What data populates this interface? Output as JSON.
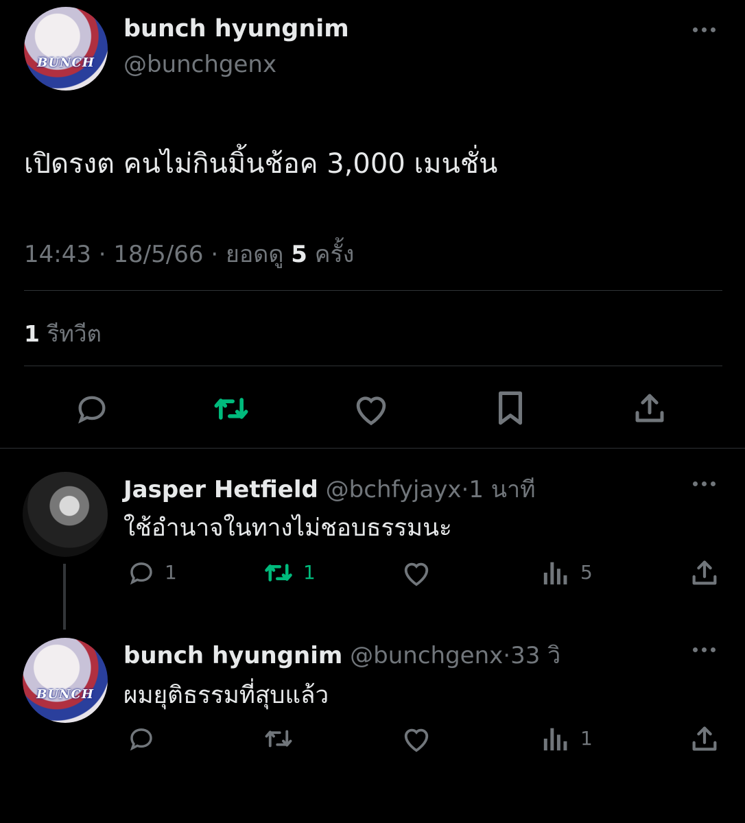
{
  "main_tweet": {
    "author_name": "bunch hyungnim",
    "author_handle": "@bunchgenx",
    "avatar_text": "BUNCH",
    "text": "เปิดรงต คนไม่กินมิ้นช้อค 3,000 เมนชั่น",
    "time": "14:43",
    "separator": "·",
    "date": "18/5/66",
    "views_prefix": "ยอดดู",
    "views_count": "5",
    "views_suffix": "ครั้ง",
    "retweet_count": "1",
    "retweet_label": "รีทวีต",
    "actions": [
      "reply-icon",
      "retweet-icon",
      "like-icon",
      "bookmark-icon",
      "share-icon"
    ]
  },
  "replies": [
    {
      "author_name": "Jasper Hetfield",
      "author_handle": "@bchfyjayx",
      "time": "1 นาที",
      "text": "ใช้อำนาจในทางไม่ชอบธรรมนะ",
      "reply_count": "1",
      "retweet_count": "1",
      "views_count": "5"
    },
    {
      "author_name": "bunch hyungnim",
      "author_handle": "@bunchgenx",
      "time": "33 วิ",
      "avatar_text": "BUNCH",
      "text": "ผมยุติธรรมที่สุบแล้ว",
      "views_count": "1"
    }
  ],
  "colors": {
    "background": "#000000",
    "text": "#e7e9ea",
    "muted": "#71767b",
    "retweet_green": "#00ba7c",
    "divider": "#2f3336"
  }
}
